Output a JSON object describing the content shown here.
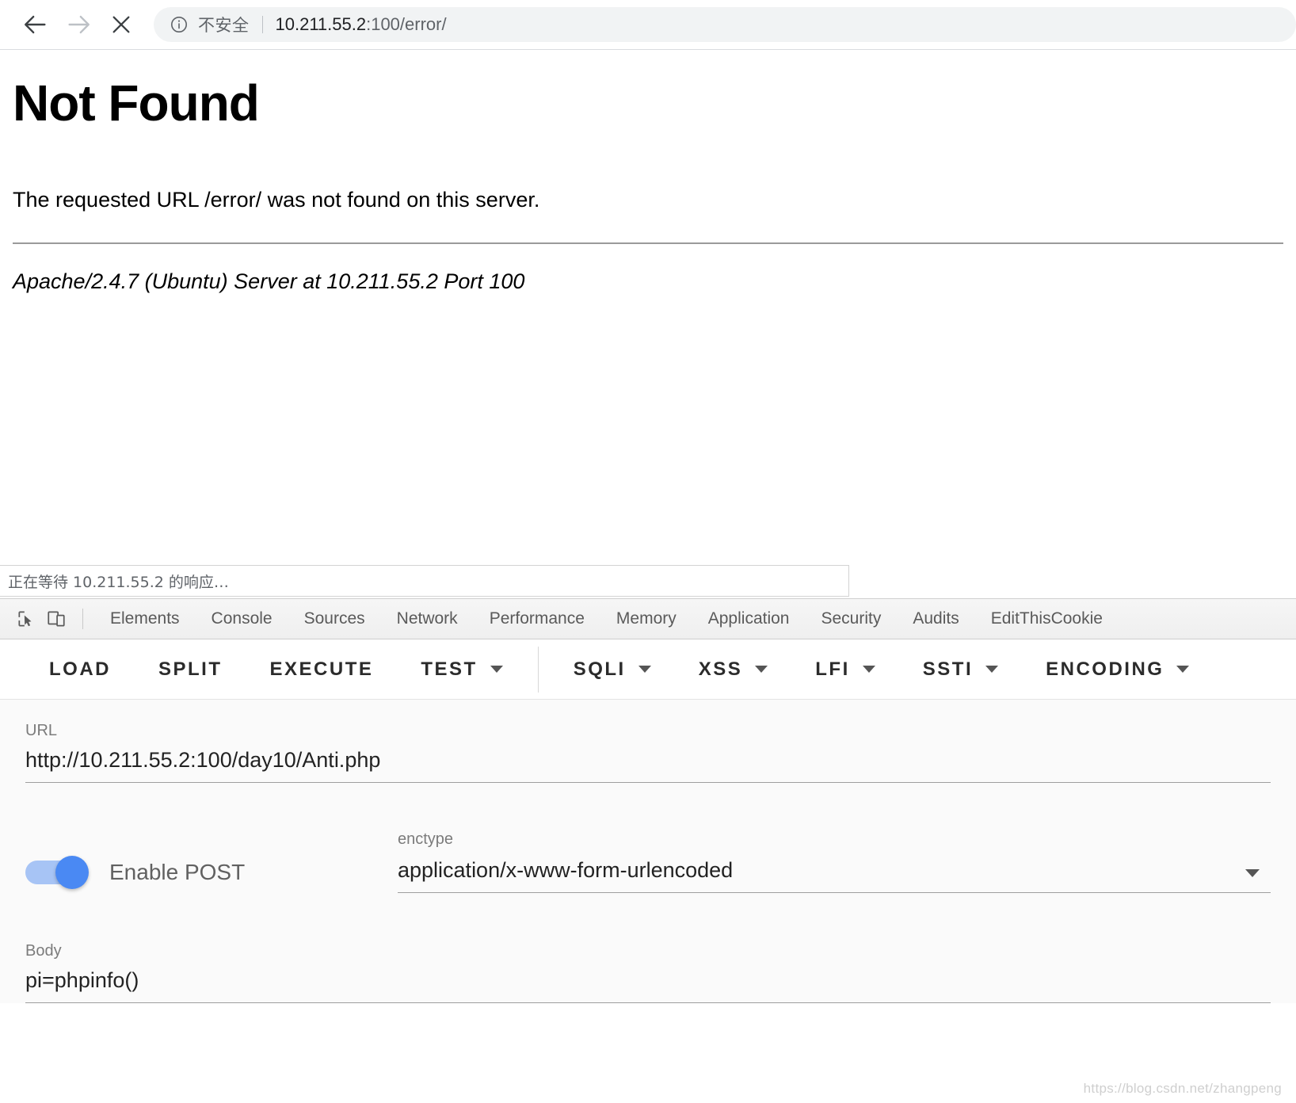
{
  "browser": {
    "back_icon": "arrow-left-icon",
    "forward_icon": "arrow-right-icon",
    "stop_icon": "close-icon",
    "security_icon": "info-circle-icon",
    "security_label": "不安全",
    "url_host": "10.211.55.2",
    "url_rest": ":100/error/",
    "url_full": "10.211.55.2:100/error/"
  },
  "page": {
    "heading": "Not Found",
    "message": "The requested URL /error/ was not found on this server.",
    "signature": "Apache/2.4.7 (Ubuntu) Server at 10.211.55.2 Port 100"
  },
  "status_bar": {
    "text": "正在等待 10.211.55.2 的响应…"
  },
  "devtools": {
    "inspect_icon": "cursor-select-icon",
    "device_toolbar_icon": "device-toggle-icon",
    "tabs": [
      {
        "label": "Elements"
      },
      {
        "label": "Console"
      },
      {
        "label": "Sources"
      },
      {
        "label": "Network"
      },
      {
        "label": "Performance"
      },
      {
        "label": "Memory"
      },
      {
        "label": "Application"
      },
      {
        "label": "Security"
      },
      {
        "label": "Audits"
      },
      {
        "label": "EditThisCookie"
      }
    ]
  },
  "hackbar": {
    "buttons": [
      {
        "label": "LOAD",
        "has_caret": false
      },
      {
        "label": "SPLIT",
        "has_caret": false
      },
      {
        "label": "EXECUTE",
        "has_caret": false
      },
      {
        "label": "TEST",
        "has_caret": true
      }
    ],
    "menus": [
      {
        "label": "SQLI",
        "has_caret": true
      },
      {
        "label": "XSS",
        "has_caret": true
      },
      {
        "label": "LFI",
        "has_caret": true
      },
      {
        "label": "SSTI",
        "has_caret": true
      },
      {
        "label": "ENCODING",
        "has_caret": true
      }
    ],
    "url": {
      "label": "URL",
      "value": "http://10.211.55.2:100/day10/Anti.php"
    },
    "post": {
      "toggle_label": "Enable POST",
      "toggle_on": true,
      "toggle_color": "#4a89f3"
    },
    "enctype": {
      "label": "enctype",
      "value": "application/x-www-form-urlencoded",
      "caret_icon": "chevron-down-icon"
    },
    "body": {
      "label": "Body",
      "value": "pi=phpinfo()"
    }
  },
  "watermark": {
    "text": "https://blog.csdn.net/zhangpeng"
  }
}
